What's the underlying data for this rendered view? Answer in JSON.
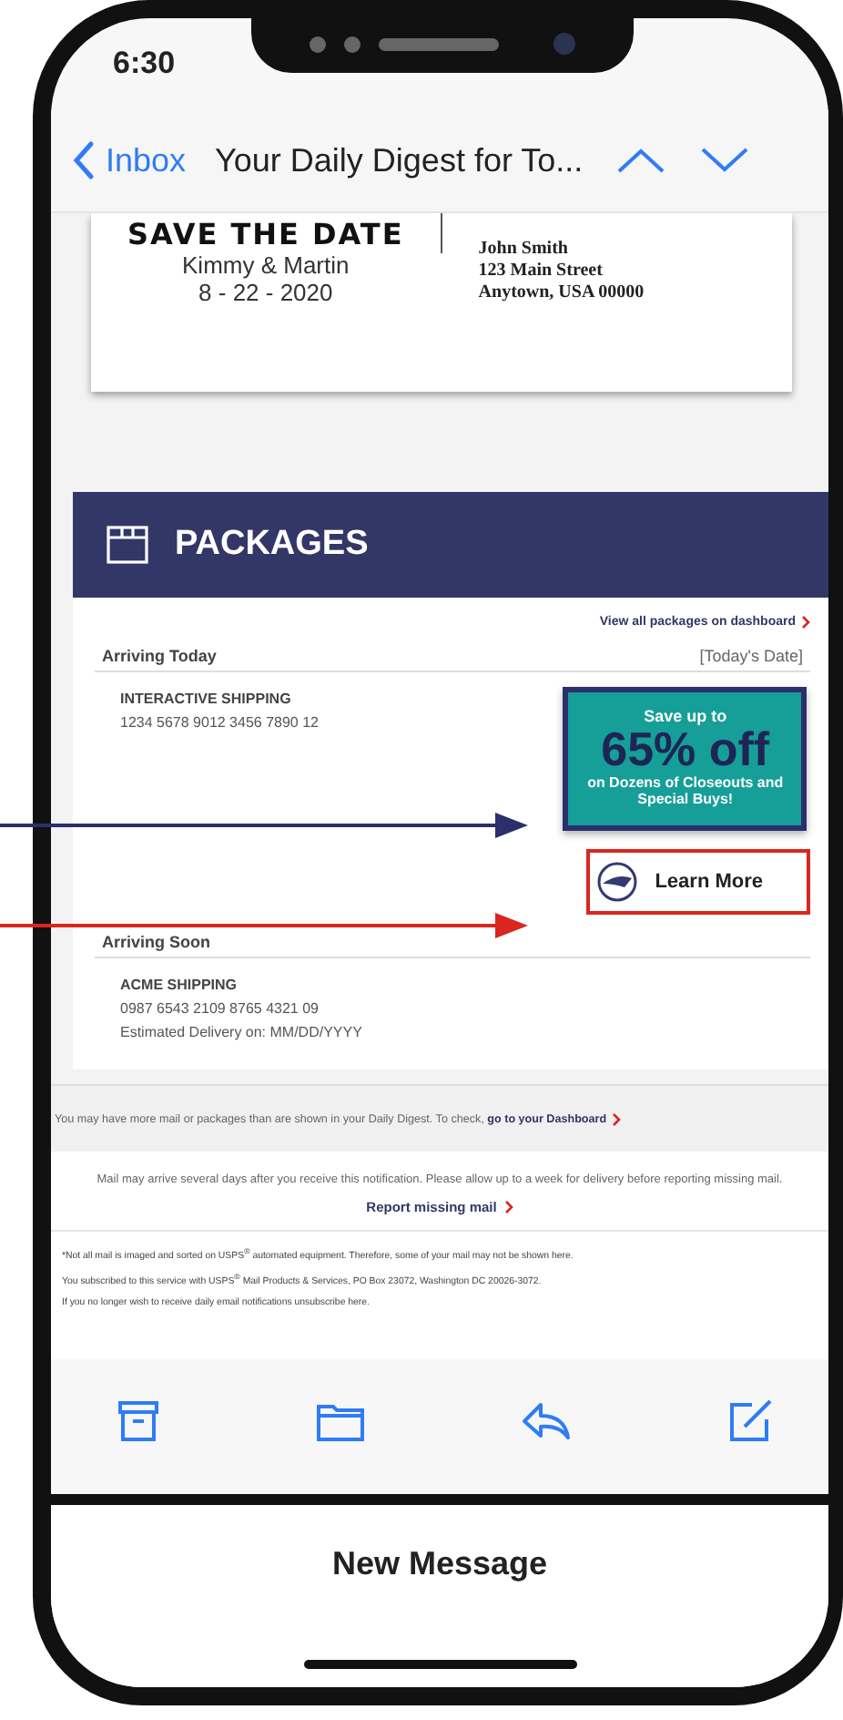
{
  "status_bar": {
    "time": "6:30"
  },
  "nav": {
    "back": "Inbox",
    "title": "Your Daily Digest for To..."
  },
  "mail_card": {
    "heading": "SAVE THE DATE",
    "names": "Kimmy & Martin",
    "date": "8 - 22 - 2020",
    "address": [
      "John Smith",
      "123 Main Street",
      "Anytown, USA 00000"
    ]
  },
  "packages": {
    "title": "PACKAGES",
    "dashboard_link": "View all packages on dashboard",
    "sections": [
      {
        "heading": "Arriving Today",
        "date": "[Today's Date]",
        "lines": [
          "INTERACTIVE  SHIPPING",
          "1234 5678 9012 3456 7890 12"
        ],
        "promo": {
          "lead": "Save up to",
          "headline": "65% off",
          "detail": "on Dozens of Closeouts and Special Buys!",
          "button": "Learn More"
        }
      },
      {
        "heading": "Arriving Soon",
        "lines": [
          "ACME SHIPPING",
          "0987 6543 2109 8765 4321 09",
          "Estimated Delivery on: MM/DD/YYYY"
        ]
      }
    ]
  },
  "notice": {
    "text": "You may have more mail or packages than are shown in your Daily Digest. To check,",
    "link": "go to your Dashboard"
  },
  "disclaimer": {
    "text": "Mail may arrive several days after you receive this notification. Please allow up to a week for delivery before reporting missing mail.",
    "link": "Report missing mail"
  },
  "footer": [
    "*Not all mail is imaged and sorted on USPS$^{®}$ automated equipment. Therefore, some of your mail may not be shown here.",
    "You subscribed to this service with USPS$^{®}$ Mail Products & Services, PO Box 23072, Washington DC 20026-3072.",
    "If you no longer wish to receive daily email notifications unsubscribe here."
  ],
  "compose_sheet": {
    "title": "New Message"
  }
}
